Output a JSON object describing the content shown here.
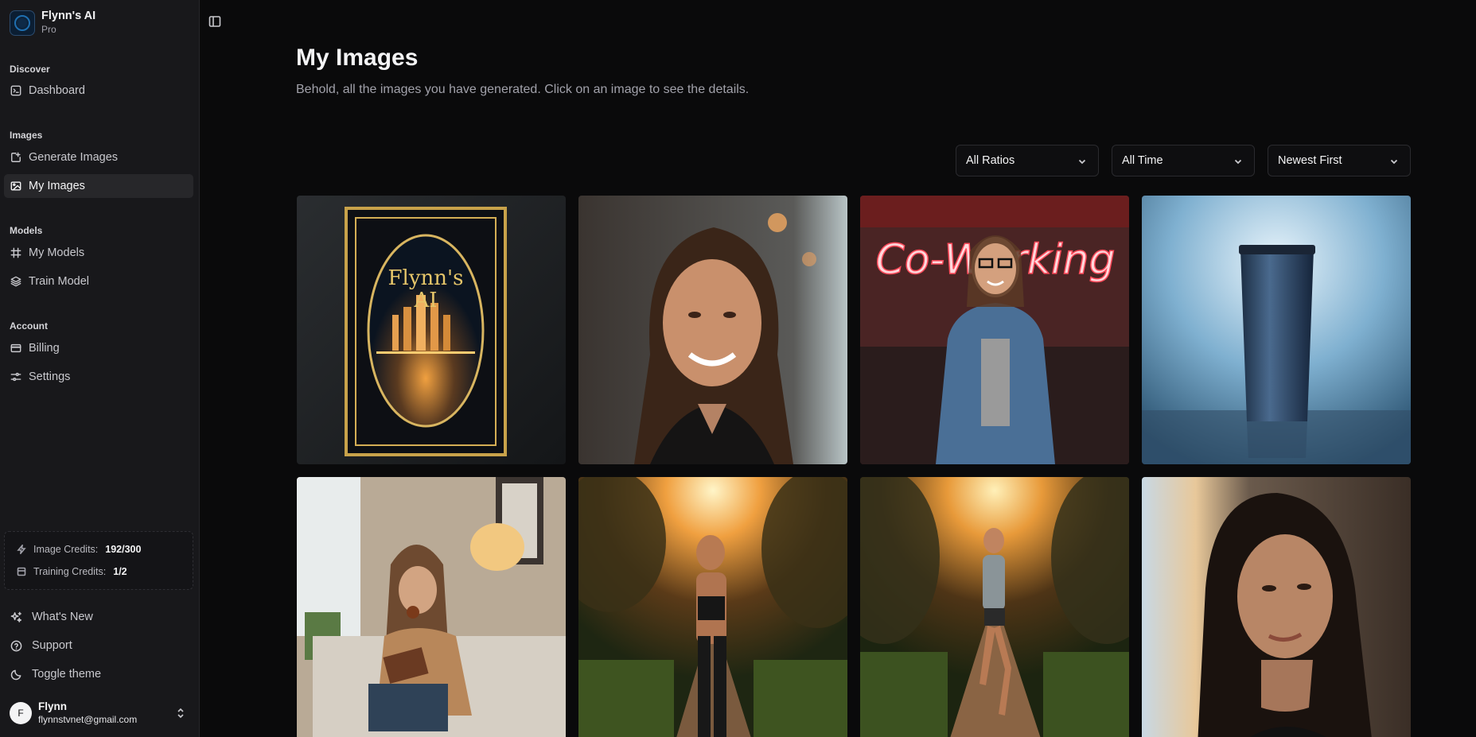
{
  "brand": {
    "name": "Flynn's AI",
    "plan": "Pro"
  },
  "sidebar": {
    "sections": [
      {
        "label": "Discover",
        "items": [
          {
            "label": "Dashboard",
            "icon": "terminal-icon"
          }
        ]
      },
      {
        "label": "Images",
        "items": [
          {
            "label": "Generate Images",
            "icon": "image-plus-icon"
          },
          {
            "label": "My Images",
            "icon": "images-icon",
            "active": true
          }
        ]
      },
      {
        "label": "Models",
        "items": [
          {
            "label": "My Models",
            "icon": "frame-icon"
          },
          {
            "label": "Train Model",
            "icon": "layers-icon"
          }
        ]
      },
      {
        "label": "Account",
        "items": [
          {
            "label": "Billing",
            "icon": "credit-card-icon"
          },
          {
            "label": "Settings",
            "icon": "sliders-icon"
          }
        ]
      }
    ],
    "credits": {
      "image_label": "Image Credits:",
      "image_value": "192/300",
      "training_label": "Training Credits:",
      "training_value": "1/2"
    },
    "footer": [
      {
        "label": "What's New",
        "icon": "sparkles-icon"
      },
      {
        "label": "Support",
        "icon": "help-circle-icon"
      },
      {
        "label": "Toggle theme",
        "icon": "moon-icon"
      }
    ],
    "user": {
      "initial": "F",
      "name": "Flynn",
      "email": "flynnstvnet@gmail.com"
    }
  },
  "main": {
    "title": "My Images",
    "subtitle": "Behold, all the images you have generated. Click on an image to see the details.",
    "filters": {
      "ratio": "All Ratios",
      "time": "All Time",
      "sort": "Newest First"
    },
    "book_text": [
      "Flynn's",
      "AI"
    ],
    "neon_text": "Co-Working",
    "images": [
      {
        "alt": "Ornate book cover"
      },
      {
        "alt": "Smiling woman portrait in cafe"
      },
      {
        "alt": "Woman in denim jacket in co-working space"
      },
      {
        "alt": "Blue tumbler product shot"
      },
      {
        "alt": "Woman reading with tea on sofa"
      },
      {
        "alt": "Woman running at sunset"
      },
      {
        "alt": "Man running on park path"
      },
      {
        "alt": "Dark-haired woman portrait"
      }
    ]
  }
}
